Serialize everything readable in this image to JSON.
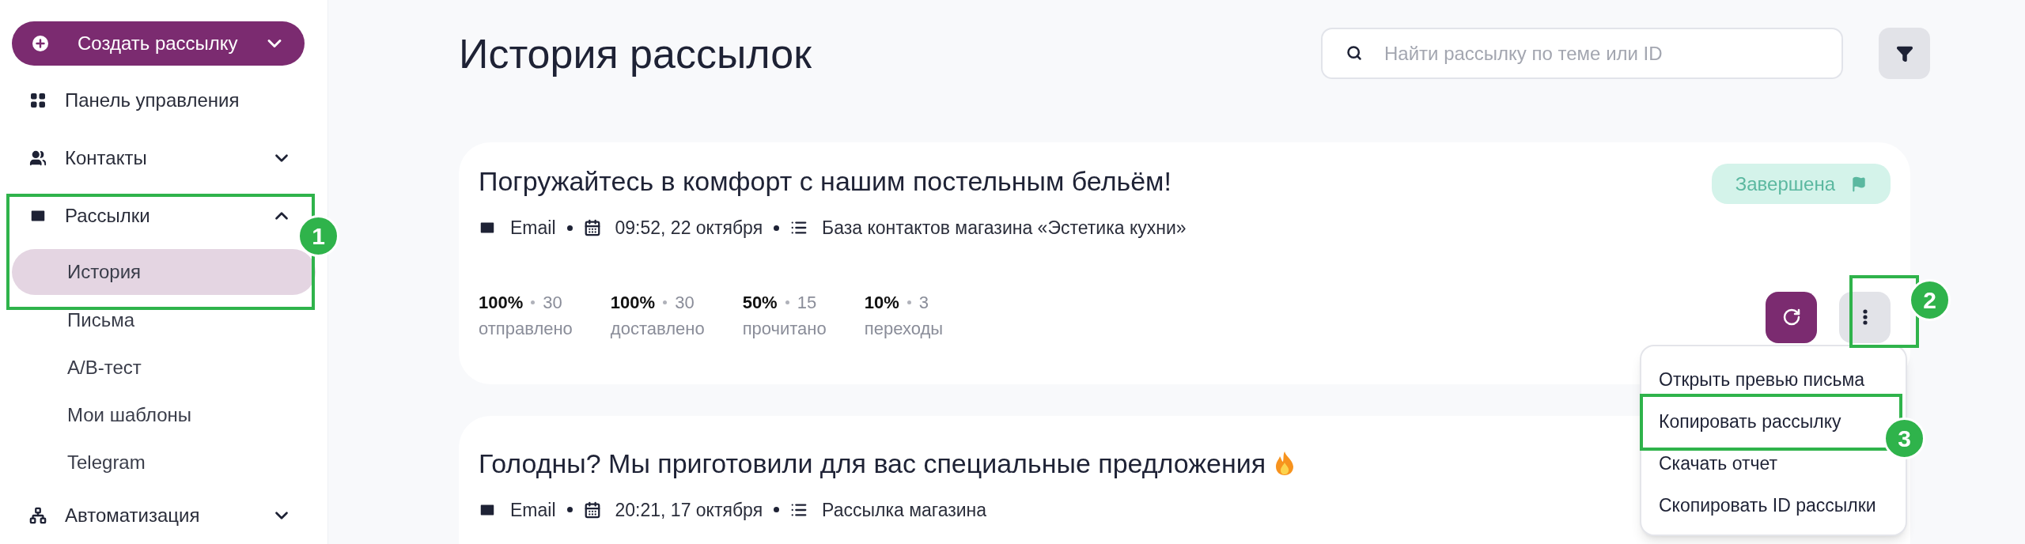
{
  "sidebar": {
    "create_button": {
      "label": "Создать рассылку"
    },
    "items": [
      {
        "label": "Панель управления"
      },
      {
        "label": "Контакты",
        "expanded": false
      },
      {
        "label": "Рассылки",
        "expanded": true,
        "children": [
          {
            "label": "История",
            "selected": true
          },
          {
            "label": "Письма",
            "selected": false
          },
          {
            "label": "A/B-тест",
            "selected": false
          },
          {
            "label": "Мои шаблоны",
            "selected": false
          },
          {
            "label": "Telegram",
            "selected": false
          }
        ]
      },
      {
        "label": "Автоматизация",
        "expanded": false
      }
    ]
  },
  "header": {
    "title": "История рассылок",
    "search": {
      "placeholder": "Найти рассылку по теме или ID"
    }
  },
  "campaigns": [
    {
      "title": "Погружайтесь в комфорт с нашим постельным бельём!",
      "status": "Завершена",
      "channel": "Email",
      "date": "09:52, 22 октября",
      "audience": "База контактов магазина «Эстетика кухни»",
      "stats": [
        {
          "percent": "100%",
          "count": "30",
          "label": "отправлено"
        },
        {
          "percent": "100%",
          "count": "30",
          "label": "доставлено"
        },
        {
          "percent": "50%",
          "count": "15",
          "label": "прочитано"
        },
        {
          "percent": "10%",
          "count": "3",
          "label": "переходы"
        }
      ],
      "menu": {
        "open": true,
        "items": [
          {
            "label": "Открыть превью письма"
          },
          {
            "label": "Копировать рассылку"
          },
          {
            "label": "Скачать отчет"
          },
          {
            "label": "Скопировать ID рассылки"
          }
        ]
      }
    },
    {
      "title": "Голодны? Мы приготовили для вас специальные предложения",
      "fire": true,
      "channel": "Email",
      "date": "20:21, 17 октября",
      "audience": "Рассылка магазина"
    }
  ],
  "annotations": [
    {
      "number": "1"
    },
    {
      "number": "2"
    },
    {
      "number": "3"
    }
  ]
}
